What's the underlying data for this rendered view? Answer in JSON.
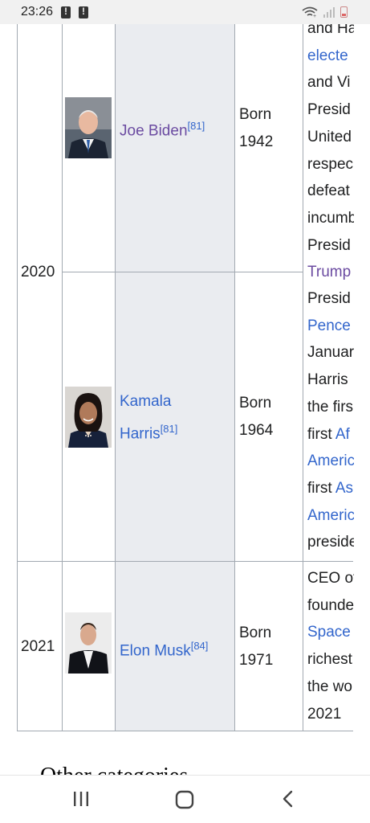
{
  "status_bar": {
    "time": "23:26"
  },
  "rows": [
    {
      "year": "2020",
      "people": [
        {
          "name_lines": [
            "Joe Biden"
          ],
          "ref": "[81]",
          "born_label": "Born",
          "born_year": "1942",
          "desc_lines": [
            {
              "text": "and Ha",
              "style": "text"
            },
            {
              "text": "electe",
              "style": "link"
            },
            {
              "text": "and Vi",
              "style": "text"
            },
            {
              "text": "Presid",
              "style": "text"
            },
            {
              "text": "United",
              "style": "text"
            },
            {
              "text": "respec",
              "style": "text"
            },
            {
              "text": "defeat",
              "style": "text"
            },
            {
              "text": "incumb",
              "style": "text"
            },
            {
              "text": "Presid",
              "style": "text"
            },
            {
              "text": "Trump",
              "style": "visited"
            }
          ]
        },
        {
          "name_lines": [
            "Kamala",
            "Harris"
          ],
          "ref": "[81]",
          "born_label": "Born",
          "born_year": "1964",
          "desc_lines": [
            {
              "text": "Presid",
              "style": "text"
            },
            {
              "text": "Pence",
              "style": "link"
            },
            {
              "text": "Januar",
              "style": "text"
            },
            {
              "text": "Harris",
              "style": "text"
            },
            {
              "text": "the firs",
              "style": "text"
            },
            {
              "text": "first Af",
              "style": "mixed",
              "plain": "first ",
              "linked": "Af"
            },
            {
              "text": "Americ",
              "style": "link"
            },
            {
              "text": "first As",
              "style": "mixed",
              "plain": "first ",
              "linked": "As"
            },
            {
              "text": "Americ",
              "style": "link"
            },
            {
              "text": "preside",
              "style": "text"
            }
          ]
        }
      ]
    },
    {
      "year": "2021",
      "people": [
        {
          "name_lines": [
            "Elon Musk"
          ],
          "ref": "[84]",
          "born_label": "Born",
          "born_year": "1971",
          "desc_lines": [
            {
              "text": "CEO of",
              "style": "text"
            },
            {
              "text": "founde",
              "style": "text"
            },
            {
              "text": "Space",
              "style": "link"
            },
            {
              "text": "richest",
              "style": "text"
            },
            {
              "text": "the wo",
              "style": "text"
            },
            {
              "text": "2021",
              "style": "text"
            }
          ]
        }
      ]
    }
  ],
  "section_heading": "Other categories",
  "navbar": {
    "icons": [
      "recent-apps-icon",
      "home-icon",
      "back-icon"
    ]
  }
}
